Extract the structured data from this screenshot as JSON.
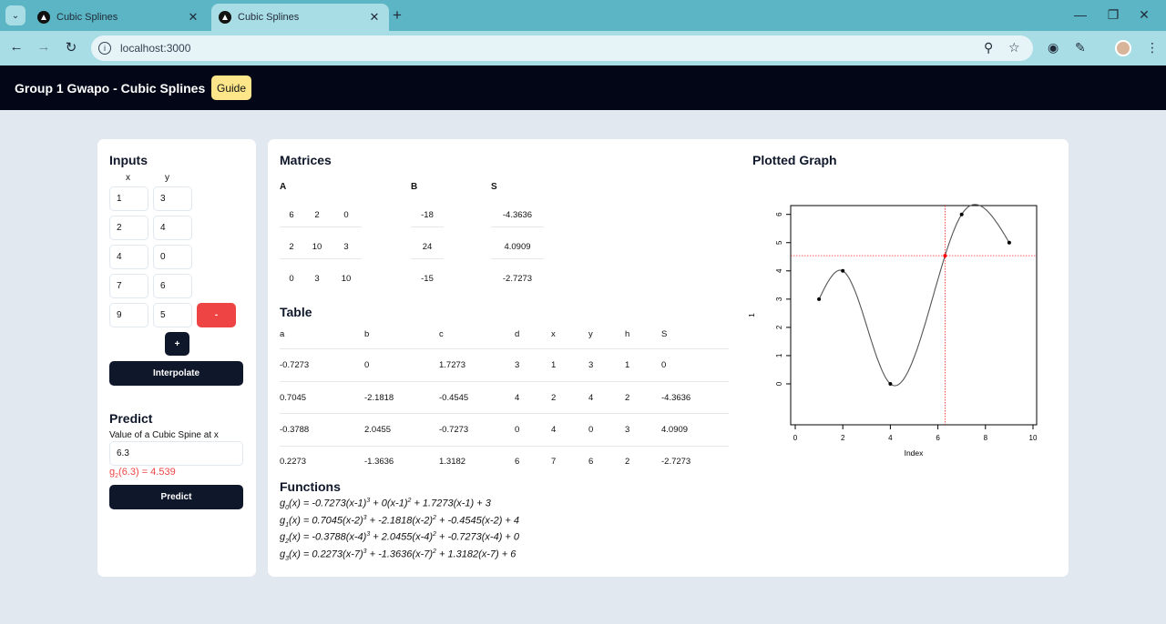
{
  "browser": {
    "tabs": [
      {
        "title": "Cubic Splines"
      },
      {
        "title": "Cubic Splines"
      }
    ],
    "url": "localhost:3000"
  },
  "header": {
    "title": "Group 1 Gwapo - Cubic Splines",
    "guide_label": "Guide"
  },
  "inputs": {
    "title": "Inputs",
    "x_header": "x",
    "y_header": "y",
    "points": [
      {
        "x": "1",
        "y": "3"
      },
      {
        "x": "2",
        "y": "4"
      },
      {
        "x": "4",
        "y": "0"
      },
      {
        "x": "7",
        "y": "6"
      },
      {
        "x": "9",
        "y": "5"
      }
    ],
    "remove_label": "-",
    "add_label": "+",
    "interpolate_label": "Interpolate"
  },
  "predict": {
    "title": "Predict",
    "label": "Value of a Cubic Spine at x",
    "value": "6.3",
    "result_fn": "g",
    "result_sub": "2",
    "result_rest": "(6.3) = 4.539",
    "button_label": "Predict"
  },
  "matrices": {
    "title": "Matrices",
    "A": {
      "label": "A",
      "rows": [
        [
          "6",
          "2",
          "0"
        ],
        [
          "2",
          "10",
          "3"
        ],
        [
          "0",
          "3",
          "10"
        ]
      ]
    },
    "B": {
      "label": "B",
      "rows": [
        [
          "-18"
        ],
        [
          "24"
        ],
        [
          "-15"
        ]
      ]
    },
    "S": {
      "label": "S",
      "rows": [
        [
          "-4.3636"
        ],
        [
          "4.0909"
        ],
        [
          "-2.7273"
        ]
      ]
    }
  },
  "table": {
    "title": "Table",
    "headers": [
      "a",
      "b",
      "c",
      "d",
      "x",
      "y",
      "h",
      "S"
    ],
    "rows": [
      [
        "-0.7273",
        "0",
        "1.7273",
        "3",
        "1",
        "3",
        "1",
        "0"
      ],
      [
        "0.7045",
        "-2.1818",
        "-0.4545",
        "4",
        "2",
        "4",
        "2",
        "-4.3636"
      ],
      [
        "-0.3788",
        "2.0455",
        "-0.7273",
        "0",
        "4",
        "0",
        "3",
        "4.0909"
      ],
      [
        "0.2273",
        "-1.3636",
        "1.3182",
        "6",
        "7",
        "6",
        "2",
        "-2.7273"
      ]
    ]
  },
  "functions": {
    "title": "Functions",
    "items": [
      {
        "g": "g",
        "sub": "0",
        "pre": "(x) = -0.7273(x-1)",
        "p3": "3",
        "mid": " + 0(x-1)",
        "p2": "2",
        "post": " + 1.7273(x-1) + 3"
      },
      {
        "g": "g",
        "sub": "1",
        "pre": "(x) = 0.7045(x-2)",
        "p3": "3",
        "mid": " + -2.1818(x-2)",
        "p2": "2",
        "post": " + -0.4545(x-2) + 4"
      },
      {
        "g": "g",
        "sub": "2",
        "pre": "(x) = -0.3788(x-4)",
        "p3": "3",
        "mid": " + 2.0455(x-4)",
        "p2": "2",
        "post": " + -0.7273(x-4) + 0"
      },
      {
        "g": "g",
        "sub": "3",
        "pre": "(x) = 0.2273(x-7)",
        "p3": "3",
        "mid": " + -1.3636(x-7)",
        "p2": "2",
        "post": " + 1.3182(x-7) + 6"
      }
    ]
  },
  "graph": {
    "title": "Plotted Graph",
    "xlabel": "Index",
    "ylabel": "1",
    "x_ticks": [
      "0",
      "2",
      "4",
      "6",
      "8",
      "10"
    ],
    "y_ticks": [
      "0",
      "1",
      "2",
      "3",
      "4",
      "5",
      "6"
    ],
    "colors": {
      "curve": "#555555",
      "points": "#000000",
      "predict": "#ff0000"
    }
  },
  "chart_data": {
    "type": "line",
    "title": "",
    "xlabel": "Index",
    "ylabel": "1",
    "xlim": [
      0,
      10
    ],
    "ylim": [
      -0.2,
      6.8
    ],
    "points": [
      [
        1,
        3
      ],
      [
        2,
        4
      ],
      [
        4,
        0
      ],
      [
        7,
        6
      ],
      [
        9,
        5
      ]
    ],
    "predicted_point": [
      6.3,
      4.539
    ],
    "splines": [
      {
        "x0": 1,
        "x1": 2,
        "xi": 1,
        "a": -0.7273,
        "b": 0,
        "c": 1.7273,
        "d": 3
      },
      {
        "x0": 2,
        "x1": 4,
        "xi": 2,
        "a": 0.7045,
        "b": -2.1818,
        "c": -0.4545,
        "d": 4
      },
      {
        "x0": 4,
        "x1": 7,
        "xi": 4,
        "a": -0.3788,
        "b": 2.0455,
        "c": -0.7273,
        "d": 0
      },
      {
        "x0": 7,
        "x1": 9,
        "xi": 7,
        "a": 0.2273,
        "b": -1.3636,
        "c": 1.3182,
        "d": 6
      }
    ],
    "grid": false
  }
}
